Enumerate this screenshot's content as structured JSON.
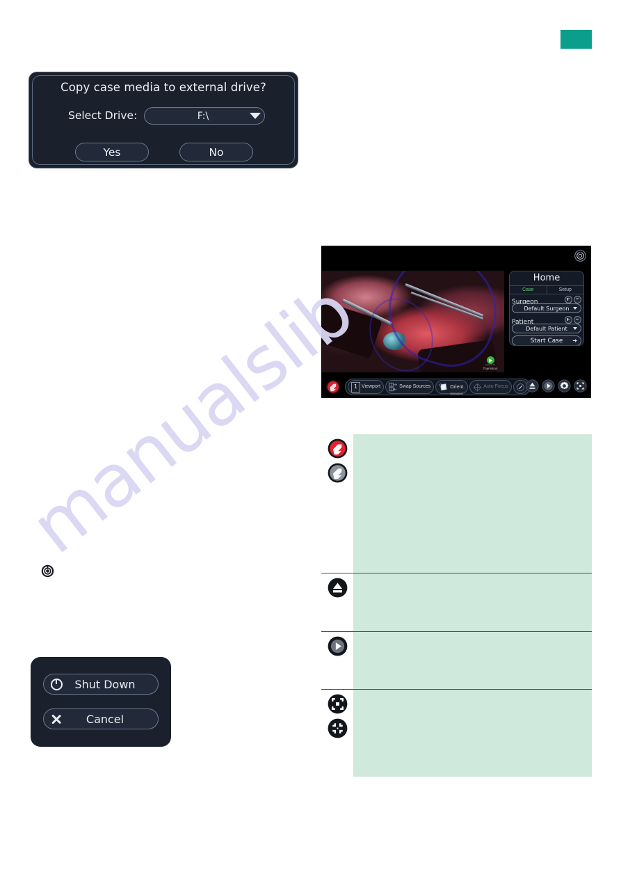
{
  "page": {
    "watermark_text": "manualslib",
    "watermark_color": "#d9d6f2",
    "teal_marker_color": "#0b9e8c",
    "table_cell_color": "#cfe9dc"
  },
  "copy_dialog": {
    "title": "Copy case media to external drive?",
    "drive_label": "Select Drive:",
    "drive_value": "F:\\",
    "drive_options": [
      "F:\\"
    ],
    "yes_label": "Yes",
    "no_label": "No",
    "caret_icon": "chevron-down-icon"
  },
  "shutdown_dialog": {
    "shutdown_label": "Shut Down",
    "cancel_label": "Cancel",
    "shutdown_icon": "power-icon",
    "cancel_icon": "close-icon"
  },
  "inline_icon": {
    "name": "settings-power-icon"
  },
  "device": {
    "power_icon": "power-icon",
    "video_logo": {
      "brand": "TrueVision",
      "tagline": "powered by"
    },
    "panel": {
      "title": "Home",
      "tabs": [
        {
          "label": "Case",
          "active": true
        },
        {
          "label": "Setup",
          "active": false
        }
      ],
      "fields": [
        {
          "label": "Surgeon",
          "value": "Default Surgeon",
          "add_icon": "plus-icon",
          "remove_icon": "minus-icon",
          "caret_icon": "chevron-down-icon"
        },
        {
          "label": "Patient",
          "value": "Default Patient",
          "add_icon": "plus-icon",
          "remove_icon": "minus-icon",
          "caret_icon": "chevron-down-icon"
        }
      ],
      "start_case": {
        "label": "Start Case",
        "icon": "arrow-right-icon"
      }
    },
    "toolbar": {
      "record_icon": "record-button-icon",
      "tools": [
        {
          "name": "viewport",
          "badge": "1",
          "label": "Viewport",
          "sub": "",
          "dim": false
        },
        {
          "name": "swap-sources",
          "badge": "",
          "label": "Swap Sources",
          "sub": "",
          "dim": false
        },
        {
          "name": "orientation",
          "badge": "",
          "label": "Orient.",
          "sub": "Standard",
          "dim": false
        },
        {
          "name": "auto-focus",
          "badge": "",
          "label": "Auto Focus",
          "sub": "",
          "dim": true
        },
        {
          "name": "edit",
          "badge": "",
          "label": "",
          "sub": "",
          "dim": false
        }
      ],
      "right_buttons": [
        {
          "name": "eject-button",
          "icon": "eject-icon"
        },
        {
          "name": "play-button",
          "icon": "play-icon"
        },
        {
          "name": "settings-button",
          "icon": "gear-icon"
        },
        {
          "name": "fullscreen-button",
          "icon": "fullscreen-icon"
        }
      ]
    }
  },
  "icon_table": {
    "rows": [
      {
        "icons": [
          {
            "name": "record-active-icon",
            "label": ""
          },
          {
            "name": "record-inactive-icon",
            "label": ""
          }
        ],
        "description": ""
      },
      {
        "icons": [
          {
            "name": "eject-icon",
            "label": ""
          }
        ],
        "description": ""
      },
      {
        "icons": [
          {
            "name": "play-icon",
            "label": ""
          }
        ],
        "description": ""
      },
      {
        "icons": [
          {
            "name": "fullscreen-expand-icon",
            "label": ""
          },
          {
            "name": "fullscreen-collapse-icon",
            "label": ""
          }
        ],
        "description": ""
      }
    ]
  }
}
